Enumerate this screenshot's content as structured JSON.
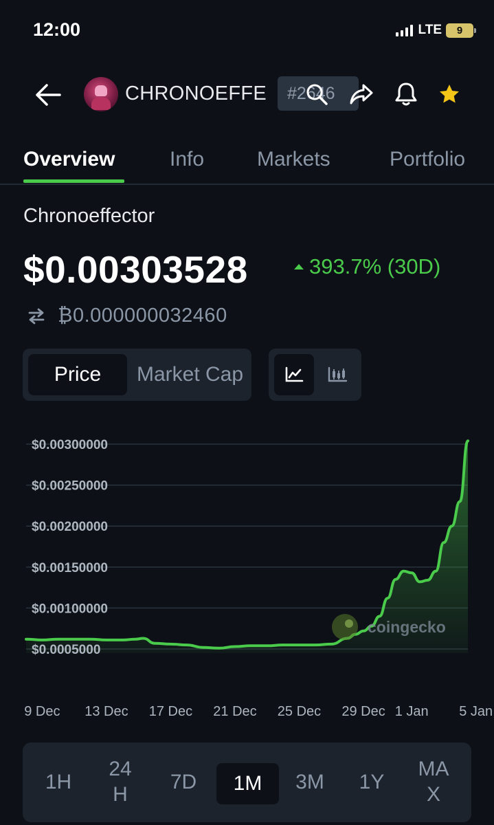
{
  "status_bar": {
    "time": "12:00",
    "network": "LTE",
    "battery": "9"
  },
  "header": {
    "coin_symbol": "CHRONOEFFE",
    "rank": "#2646",
    "icons": [
      "back-arrow-icon",
      "coin-logo",
      "search-icon",
      "share-icon",
      "bell-icon",
      "star-icon"
    ],
    "star_color": "#f5c518"
  },
  "tabs": [
    "Overview",
    "Info",
    "Markets",
    "Portfolio"
  ],
  "active_tab": "Overview",
  "coin": {
    "name": "Chronoeffector",
    "price": "$0.00303528",
    "change": "393.7% (30D)",
    "btc_price": "₿0.000000032460"
  },
  "toggles": {
    "metric": [
      "Price",
      "Market Cap"
    ],
    "active_metric": "Price",
    "chart_types": [
      "line-chart-icon",
      "candlestick-chart-icon"
    ],
    "active_chart_type": "line-chart-icon"
  },
  "chart_data": {
    "type": "area",
    "x_labels": [
      "9 Dec",
      "13 Dec",
      "17 Dec",
      "21 Dec",
      "25 Dec",
      "29 Dec",
      "1 Jan",
      "5 Jan"
    ],
    "y_tick_labels": [
      "$0.00300000",
      "$0.00250000",
      "$0.00200000",
      "$0.00150000",
      "$0.00100000",
      "$0.0005000"
    ],
    "y_ticks": [
      0.003,
      0.0025,
      0.002,
      0.0015,
      0.001,
      0.0005
    ],
    "ylim": [
      0.00045,
      0.003
    ],
    "x_range": [
      8.0,
      35.5
    ],
    "x_label_days": [
      9,
      13,
      17,
      21,
      25,
      29,
      32,
      36
    ],
    "x": [
      8.0,
      9.0,
      10.0,
      11.0,
      12.0,
      13.0,
      14.0,
      14.8,
      15.3,
      16.0,
      17.0,
      18.0,
      19.0,
      20.0,
      21.0,
      22.0,
      23.0,
      24.0,
      25.0,
      26.0,
      27.0,
      28.0,
      28.5,
      29.0,
      29.5,
      30.0,
      30.5,
      31.0,
      31.5,
      32.0,
      32.5,
      33.0,
      33.5,
      34.0,
      34.5,
      35.0,
      35.5
    ],
    "values": [
      0.00062,
      0.00061,
      0.00062,
      0.00062,
      0.00062,
      0.00061,
      0.00061,
      0.00062,
      0.00063,
      0.00057,
      0.00056,
      0.00055,
      0.00052,
      0.00051,
      0.00053,
      0.00054,
      0.00054,
      0.00055,
      0.00055,
      0.00055,
      0.00056,
      0.00063,
      0.00068,
      0.00072,
      0.00078,
      0.0009,
      0.00112,
      0.00135,
      0.00145,
      0.00143,
      0.00132,
      0.00134,
      0.00145,
      0.0018,
      0.002,
      0.0023,
      0.00304
    ],
    "line_color": "#4bcb4b",
    "watermark": "coingecko",
    "grid": true
  },
  "ranges": [
    "1H",
    "24\nH",
    "7D",
    "1M",
    "3M",
    "1Y",
    "MA\nX"
  ],
  "active_range": "1M"
}
